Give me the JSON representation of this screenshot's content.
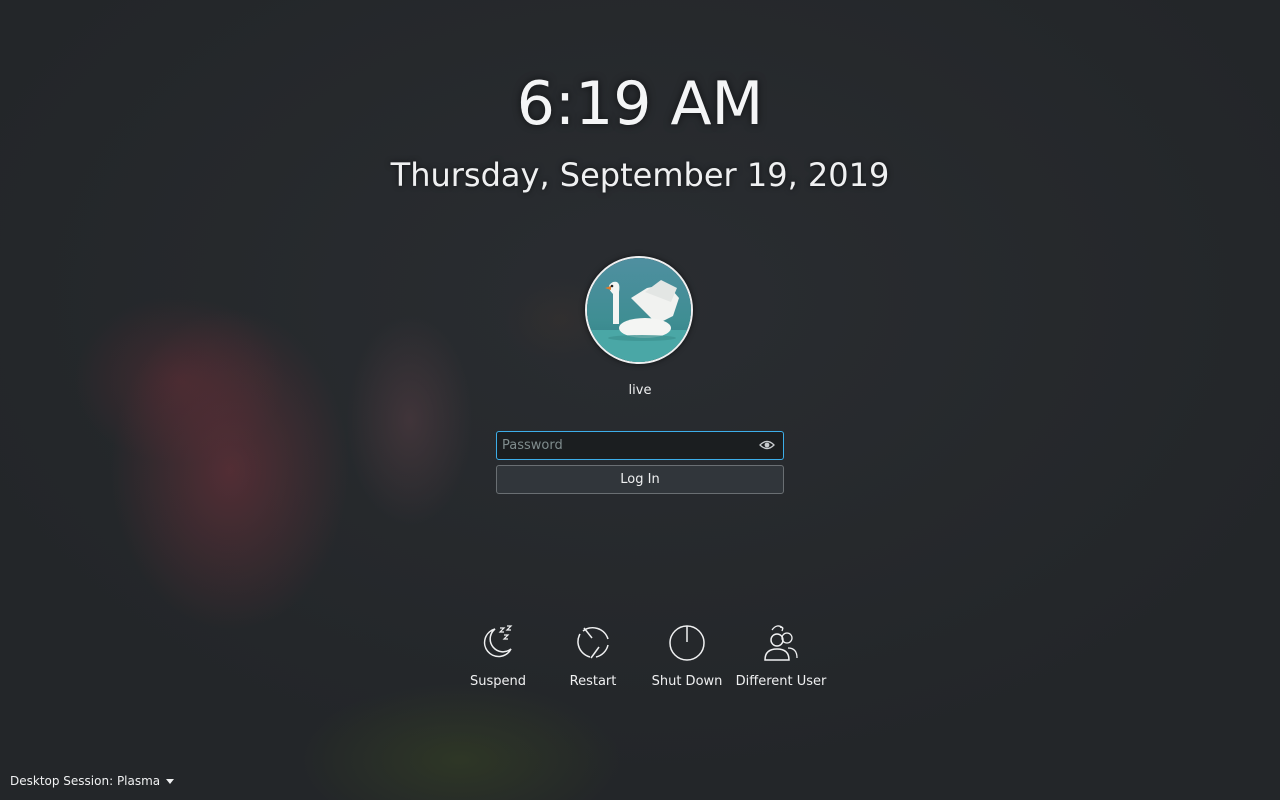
{
  "lockscreen": {
    "time": "6:19 AM",
    "date": "Thursday, September 19, 2019"
  },
  "user": {
    "name": "live",
    "avatar_icon": "swan-avatar-icon"
  },
  "login": {
    "password_placeholder": "Password",
    "password_value": "",
    "reveal_icon": "eye-icon",
    "login_label": "Log In"
  },
  "actions": [
    {
      "label": "Suspend",
      "icon": "suspend-icon"
    },
    {
      "label": "Restart",
      "icon": "restart-icon"
    },
    {
      "label": "Shut Down",
      "icon": "shutdown-icon"
    },
    {
      "label": "Different User",
      "icon": "different-user-icon"
    }
  ],
  "session": {
    "label": "Desktop Session: Plasma"
  },
  "colors": {
    "background": "#232629",
    "accent": "#3daee9",
    "text": "#eff0f1"
  }
}
